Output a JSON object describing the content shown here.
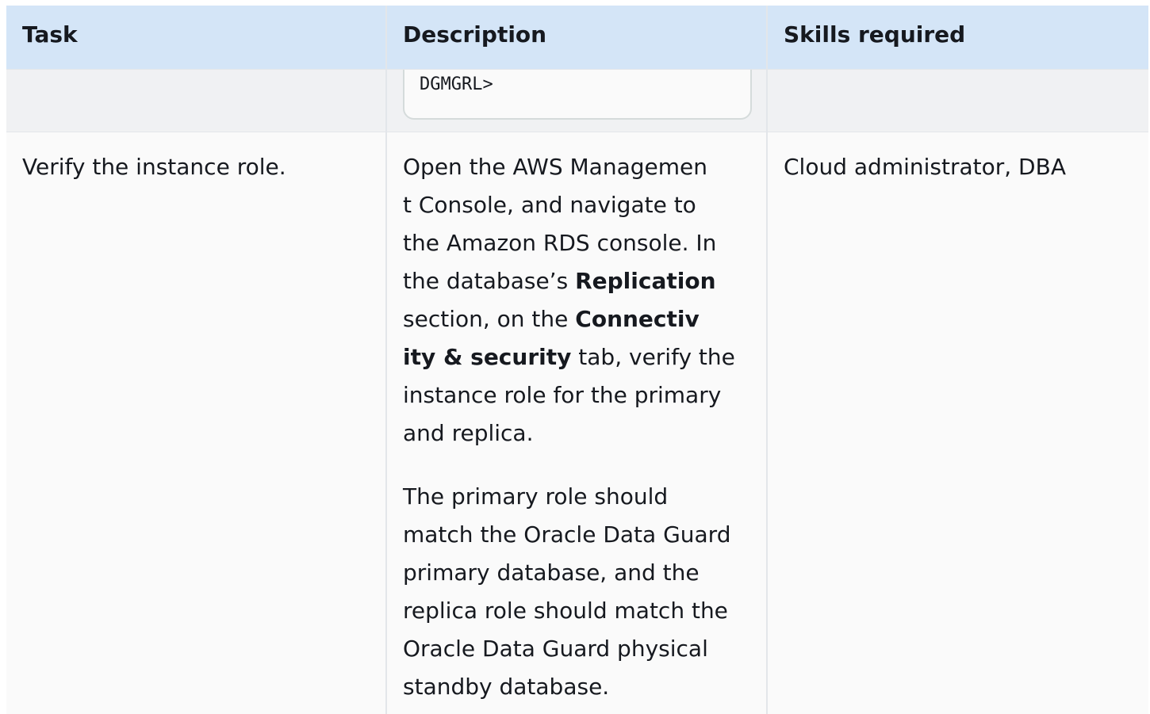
{
  "table": {
    "headers": {
      "task": "Task",
      "description": "Description",
      "skills": "Skills required"
    },
    "prev_row": {
      "code": "DGMGRL>"
    },
    "row": {
      "task": "Verify the instance role.",
      "description": {
        "p1": {
          "t1": "Open the AWS Managemen",
          "t2": "t Console, and navigate to",
          "t3": "the Amazon RDS console. In",
          "t4": "the database’s ",
          "b1": "Replication",
          "t5": "section, on the ",
          "b2a": "Connectiv",
          "b2b": "ity & security",
          "t6": " tab, verify the",
          "t7": "instance role for the primary",
          "t8": "and replica."
        },
        "p2": {
          "l1": "The primary role should",
          "l2": "match the Oracle Data Guard",
          "l3": "primary database, and the",
          "l4": "replica role should match the",
          "l5": "Oracle Data Guard physical",
          "l6": "standby database."
        }
      },
      "skills": "Cloud administrator, DBA"
    }
  }
}
